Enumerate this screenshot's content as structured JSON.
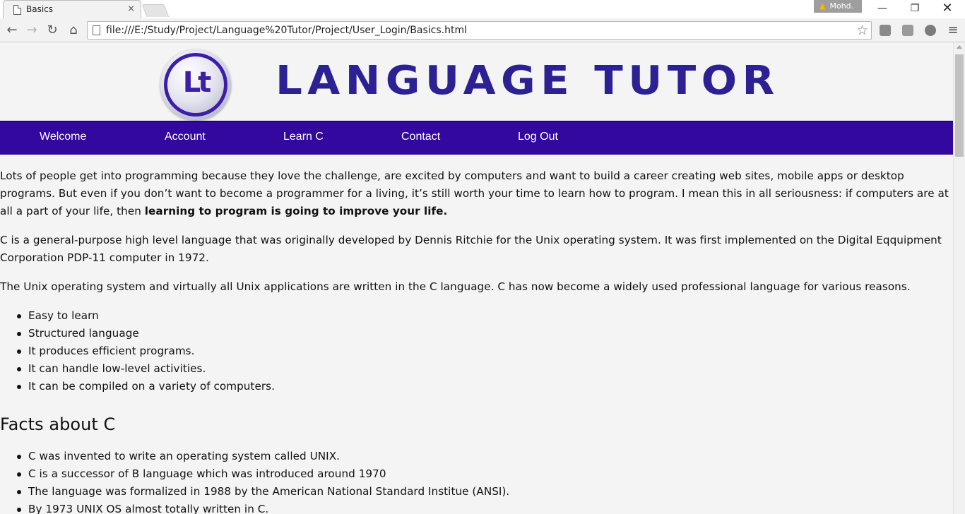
{
  "browser": {
    "tab_title": "Basics",
    "tab_close": "×",
    "profile_name": "Mohd.",
    "url": "file:///E:/Study/Project/Language%20Tutor/Project/User_Login/Basics.html",
    "window_min": "—",
    "window_max": "❐",
    "window_close": "✕",
    "back": "←",
    "forward": "→",
    "reload": "↻",
    "home": "⌂",
    "bookmark_star": "☆",
    "menu": "≡",
    "icons": [
      "document-icon",
      "warning-icon",
      "back-arrow-icon",
      "forward-arrow-icon",
      "reload-icon",
      "home-icon",
      "star-icon",
      "extension-icon",
      "hamburger-menu-icon"
    ]
  },
  "site": {
    "logo_text": "Lt",
    "brand": "LANGUAGE TUTOR",
    "nav": [
      "Welcome",
      "Account",
      "Learn C",
      "Contact",
      "Log Out"
    ],
    "colors": {
      "nav_bg": "#33089e",
      "brand": "#2b2192",
      "page_bg": "#f4f4f4"
    }
  },
  "content": {
    "para1_text": "Lots of people get into programming because they love the challenge, are excited by computers and want to build a career creating web sites, mobile apps or desktop programs. But even if you don’t want to become a programmer for a living, it’s still worth your time to learn how to program. I mean this in all seriousness: if computers are at all a part of your life, then ",
    "para1_bold": "learning to program is going to improve your life.",
    "para2": "C is a general-purpose high level language that was originally developed by Dennis Ritchie for the Unix operating system. It was first implemented on the Digital Eqquipment Corporation PDP-11 computer in 1972.",
    "para3": "The Unix operating system and virtually all Unix applications are written in the C language. C has now become a widely used professional language for various reasons.",
    "reasons": [
      "Easy to learn",
      "Structured language",
      "It produces efficient programs.",
      "It can handle low-level activities.",
      "It can be compiled on a variety of computers."
    ],
    "facts_heading": "Facts about C",
    "facts": [
      "C was invented to write an operating system called UNIX.",
      "C is a successor of B language which was introduced around 1970",
      "The language was formalized in 1988 by the American National Standard Institue (ANSI).",
      "By 1973 UNIX OS almost totally written in C."
    ]
  }
}
